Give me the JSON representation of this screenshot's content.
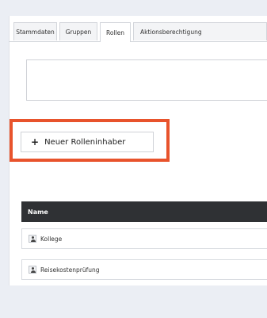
{
  "tabs": [
    {
      "label": "Stammdaten"
    },
    {
      "label": "Gruppen"
    },
    {
      "label": "Rollen",
      "active": true
    },
    {
      "label": "Aktionsberechtigung"
    }
  ],
  "add_button": {
    "icon": "plus-icon",
    "label": "Neuer Rolleninhaber"
  },
  "highlight_color": "#e8532c",
  "table": {
    "header": "Name",
    "rows": [
      {
        "icon": "user-icon",
        "label": "Kollege"
      },
      {
        "icon": "user-icon",
        "label": "Reisekostenprüfung"
      }
    ]
  }
}
